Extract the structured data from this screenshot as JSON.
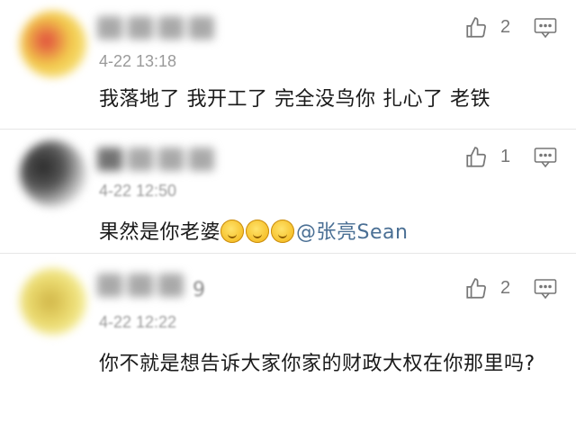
{
  "comments": [
    {
      "time": "4-22 13:18",
      "text": "我落地了 我开工了 完全没鸟你 扎心了 老铁",
      "likes": "2",
      "avatar_colors": [
        "#f2c94c",
        "#e0483d",
        "#f7e27a"
      ]
    },
    {
      "time": "4-22 12:50",
      "text": "果然是你老婆",
      "mention": "@张亮Sean",
      "likes": "1",
      "avatar_colors": [
        "#3a3a3a",
        "#cfcfcf",
        "#8a8a8a"
      ]
    },
    {
      "time": "4-22 12:22",
      "name_tail": "9",
      "text": "你不就是想告诉大家你家的财政大权在你那里吗?",
      "likes": "2",
      "avatar_colors": [
        "#e8d66a",
        "#f6ef9a",
        "#d0b548"
      ]
    }
  ],
  "icons": {
    "like": "thumbs-up-icon",
    "reply": "comment-icon"
  },
  "colors": {
    "mention": "#4a6f94",
    "meta": "#9a9a9a",
    "divider": "#e6e6e6"
  }
}
